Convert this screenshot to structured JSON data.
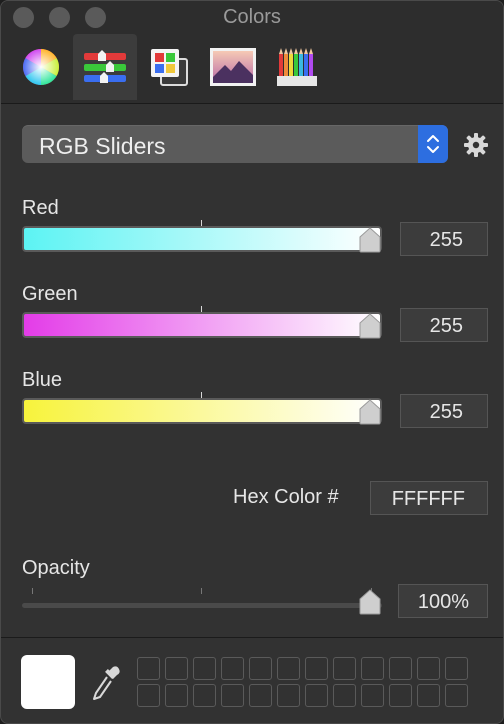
{
  "window": {
    "title": "Colors"
  },
  "tabs": [
    {
      "name": "color-wheel",
      "icon": "color-wheel-icon"
    },
    {
      "name": "color-sliders",
      "icon": "sliders-icon"
    },
    {
      "name": "color-palettes",
      "icon": "palettes-icon"
    },
    {
      "name": "image-palettes",
      "icon": "image-palette-icon"
    },
    {
      "name": "pencils",
      "icon": "pencils-icon"
    }
  ],
  "mode_popup": {
    "selected": "RGB Sliders"
  },
  "sliders": {
    "red": {
      "label": "Red",
      "value": "255",
      "fraction": 1.0
    },
    "green": {
      "label": "Green",
      "value": "255",
      "fraction": 1.0
    },
    "blue": {
      "label": "Blue",
      "value": "255",
      "fraction": 1.0
    }
  },
  "hex": {
    "label": "Hex Color #",
    "value": "FFFFFF"
  },
  "opacity": {
    "label": "Opacity",
    "value": "100%",
    "fraction": 1.0
  },
  "current_color": "#FFFFFF",
  "colors": {
    "accent": "#2D6EE0",
    "red_track_start": "#5CF3F3",
    "green_track_start": "#E33CE8",
    "blue_track_start": "#F7F33C"
  }
}
